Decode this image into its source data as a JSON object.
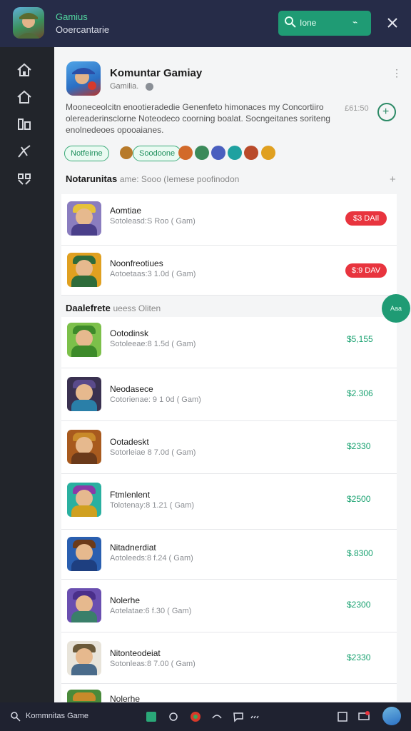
{
  "header": {
    "app_title": "Gamius",
    "app_subtitle": "Ooercantarie",
    "search_label": "Ione",
    "search_shortcut": "⌁"
  },
  "sidebar": {
    "items": [
      {
        "icon": "home-icon"
      },
      {
        "icon": "home-outline-icon"
      },
      {
        "icon": "library-icon"
      },
      {
        "icon": "tools-icon"
      },
      {
        "icon": "grid-icon"
      }
    ]
  },
  "featured": {
    "title": "Komuntar Gamiay",
    "subtitle": "Gamilia.",
    "description": "Mooneceolcitn enootieradedie Genenfeto himonaces my Concortiiro olereaderinsclorne Noteodeco coorning boalat. Socngeitanes soriteng enolnedeoes opooaianes.",
    "meta_time": "£61:50",
    "more_label": "⋮"
  },
  "chips": {
    "primary": "Notfeirne",
    "secondary": "Soodoone"
  },
  "section1": {
    "title": "Notarunitas",
    "subtitle": "ame: Sooo (Iemese poofinodon"
  },
  "featured_list": [
    {
      "name": "Aomtiae",
      "meta": "Sotoleasd:S Roo ( Gam)",
      "price": "$3 DAIl"
    },
    {
      "name": "Noonfreotiues",
      "meta": "Aotoetaas:3 1.0d ( Gam)",
      "price": "$:9 DAV"
    }
  ],
  "section2": {
    "title": "Daalefrete",
    "subtitle": "ueess Oliten"
  },
  "games": [
    {
      "name": "Ootodinsk",
      "meta": "Sotoleeae:8 1.5d ( Gam)",
      "price": "$5,155"
    },
    {
      "name": "Neodasece",
      "meta": "Cotorienae: 9 1 0d ( Gam)",
      "price": "$2.306"
    },
    {
      "name": "Ootadeskt",
      "meta": "Sotorleiae 8 7.0d ( Gam)",
      "price": "$2330"
    },
    {
      "name": "Ftmlenlent",
      "meta": "Tolotenay:8 1.21 ( Gam)",
      "price": "$2500"
    },
    {
      "name": "Nitadnerdiat",
      "meta": "Aotoleeds:8 f.24 ( Gam)",
      "price": "$.8300"
    },
    {
      "name": "Nolerhe",
      "meta": "Aotelatae:6 f.30 ( Gam)",
      "price": "$2300"
    },
    {
      "name": "Nitonteodeiat",
      "meta": "Sotonleas:8 7.00 ( Gam)",
      "price": "$2330"
    },
    {
      "name": "Nolerhe",
      "meta": "",
      "price": ""
    }
  ],
  "fab_label": "Aaa",
  "taskbar": {
    "search_text": "Kommnitas Game"
  },
  "colors": {
    "accent": "#1f9b74",
    "price_green": "#1aa271",
    "badge_red": "#e8343e",
    "topbar": "#262c48",
    "sidebar": "#22252b"
  }
}
